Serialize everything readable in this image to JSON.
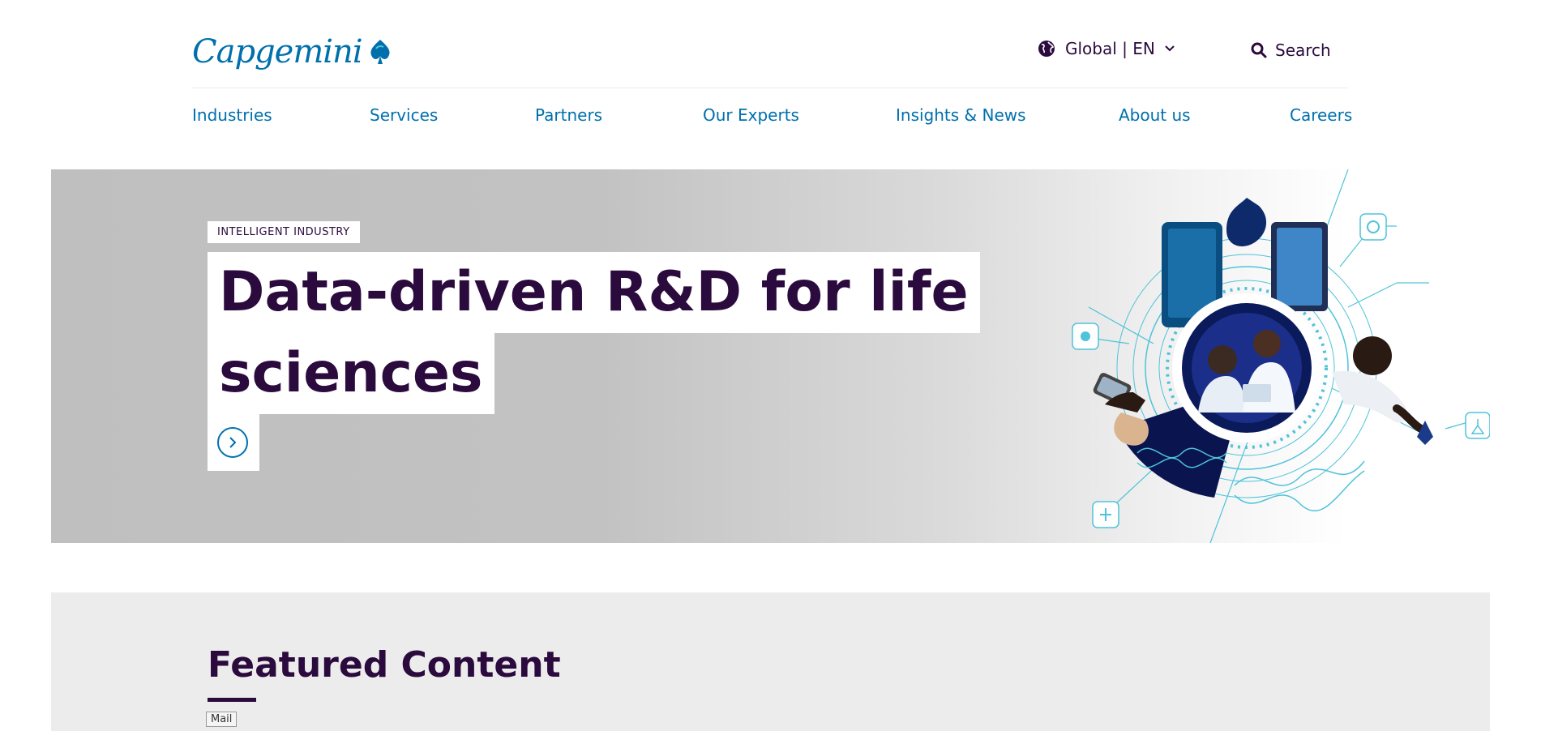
{
  "header": {
    "logo_text": "Capgemini",
    "locale_label": "Global | EN",
    "search_label": "Search"
  },
  "nav": {
    "items": [
      {
        "label": "Industries"
      },
      {
        "label": "Services"
      },
      {
        "label": "Partners"
      },
      {
        "label": "Our Experts"
      },
      {
        "label": "Insights & News"
      },
      {
        "label": "About us"
      },
      {
        "label": "Careers"
      }
    ]
  },
  "hero": {
    "tag": "INTELLIGENT INDUSTRY",
    "title_line1": "Data-driven R&D for life",
    "title_line2": "sciences",
    "cta_icon": "chevron-right-icon",
    "illustration_icon": "life-sciences-illustration"
  },
  "featured": {
    "title": "Featured Content",
    "mail_label": "Mail"
  },
  "colors": {
    "brand_blue": "#0070ad",
    "dark_purple": "#2b0a3d",
    "hero_gray": "#bfbfbf",
    "featured_bg": "#ececec",
    "accent_teal": "#4fc3d9"
  }
}
